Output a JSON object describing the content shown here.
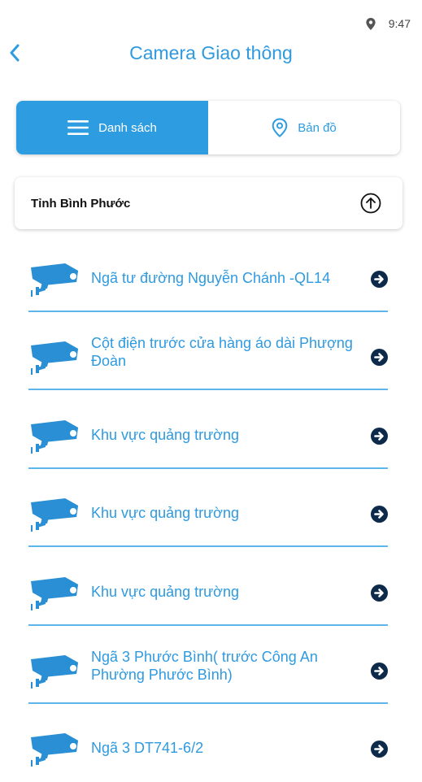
{
  "status_bar": {
    "time": "9:47"
  },
  "app_bar": {
    "title": "Camera Giao thông"
  },
  "tabs": {
    "list_label": "Danh sách",
    "map_label": "Bản đồ"
  },
  "province": {
    "name": "Tỉnh Bình Phước"
  },
  "cameras": [
    {
      "label": "Ngã tư đường Nguyễn Chánh -QL14"
    },
    {
      "label": "Cột điện trước cửa hàng áo dài Phượng Đoàn"
    },
    {
      "label": "Khu vực quảng trường"
    },
    {
      "label": "Khu vực quảng trường"
    },
    {
      "label": "Khu vực quảng trường"
    },
    {
      "label": "Ngã 3 Phước Bình( trước Công An Phường Phước Bình)"
    },
    {
      "label": "Ngã 3 DT741-6/2"
    }
  ],
  "colors": {
    "accent": "#2d9ce0",
    "camera_icon": "#2a8fd4",
    "arrow_icon": "#0d2a4a",
    "divider": "#5db5ea"
  },
  "icons": {
    "back": "chevron-left-icon",
    "menu": "menu-icon",
    "map": "location-pin-icon",
    "collapse": "arrow-up-circle-icon",
    "row_camera": "camera-icon",
    "row_arrow": "arrow-right-circle-icon"
  }
}
